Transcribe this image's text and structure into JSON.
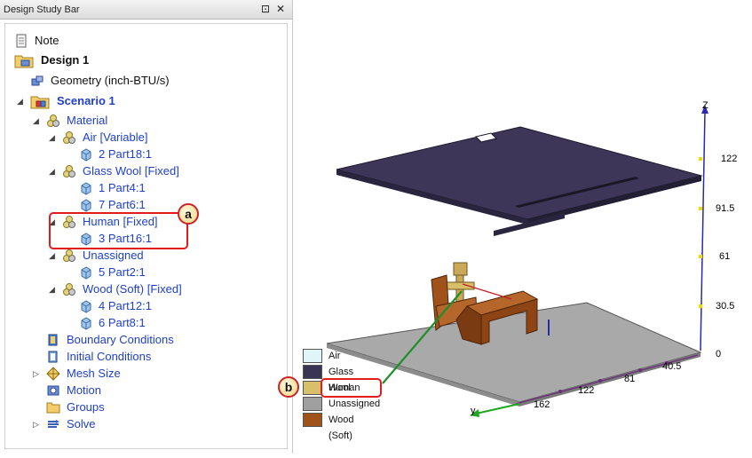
{
  "panel": {
    "title": "Design Study Bar",
    "pin_glyph": "⊡",
    "close_glyph": "✕"
  },
  "tree": {
    "note": "Note",
    "design": "Design 1",
    "geometry": "Geometry (inch-BTU/s)",
    "scenario": "Scenario 1",
    "material": "Material",
    "air": "Air [Variable]",
    "air_part": "2 Part18:1",
    "glass_wool": "Glass Wool [Fixed]",
    "glass_part1": "1 Part4:1",
    "glass_part2": "7 Part6:1",
    "human": "Human [Fixed]",
    "human_part": "3 Part16:1",
    "unassigned": "Unassigned",
    "unassigned_part": "5 Part2:1",
    "wood": "Wood (Soft) [Fixed]",
    "wood_part1": "4 Part12:1",
    "wood_part2": "6 Part8:1",
    "boundary": "Boundary Conditions",
    "initial": "Initial Conditions",
    "mesh": "Mesh Size",
    "motion": "Motion",
    "groups": "Groups",
    "solve": "Solve"
  },
  "callouts": {
    "a": "a",
    "b": "b"
  },
  "legend": [
    {
      "label": "Air",
      "color": "#dff5f8"
    },
    {
      "label": "Glass Wool",
      "color": "#3b3555"
    },
    {
      "label": "Human",
      "color": "#d8bf6a"
    },
    {
      "label": "Unassigned",
      "color": "#a0a0a0"
    },
    {
      "label": "Wood (Soft)",
      "color": "#a0521b"
    }
  ],
  "axes": {
    "z_label": "Z",
    "y_label": "y",
    "z_ticks": [
      "122",
      "91.5",
      "61",
      "30.5",
      "0"
    ],
    "base_ticks": [
      "40.5",
      "81",
      "122",
      "162"
    ]
  },
  "colors": {
    "tree_link": "#1f3fc9",
    "callout": "#e31b1b",
    "axis_z": "#2a2aa8",
    "axis_y": "#1fa81f",
    "tick": "#f0d800"
  }
}
